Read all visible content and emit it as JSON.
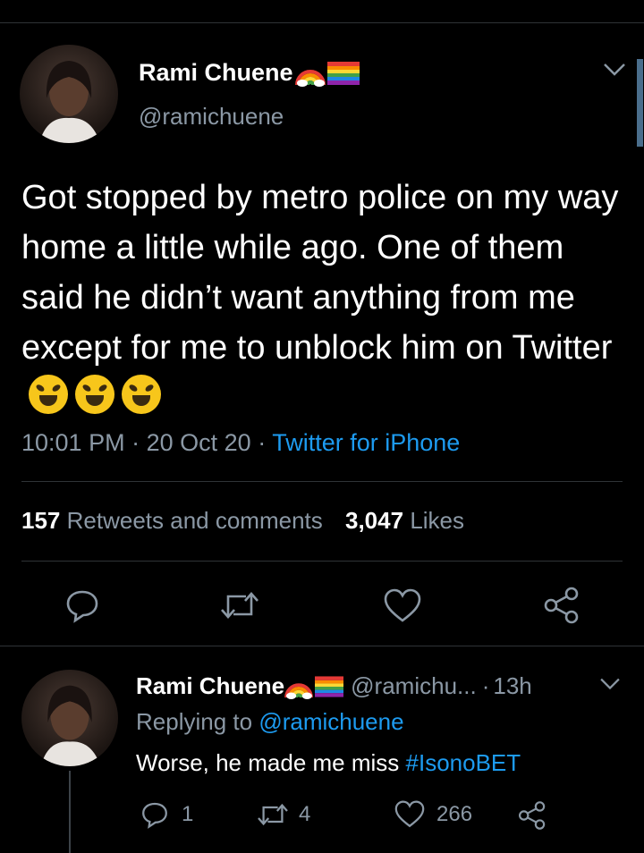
{
  "main_tweet": {
    "display_name": "Rami Chuene",
    "handle": "@ramichuene",
    "text": "Got stopped by metro police on my way home a little while ago. One of them said he didn’t want anything from me except for me to unblock him on Twitter",
    "emoji": "🤣🤣🤣",
    "time": "10:01 PM",
    "date": "20 Oct 20",
    "source": "Twitter for iPhone",
    "retweets_count": "157",
    "retweets_label": "Retweets and comments",
    "likes_count": "3,047",
    "likes_label": "Likes",
    "sep": "·"
  },
  "reply": {
    "display_name": "Rami Chuene",
    "handle": "@ramichu...",
    "age": "13h",
    "replying_prefix": "Replying to",
    "replying_handle": "@ramichuene",
    "text_prefix": "Worse, he made me miss",
    "hashtag": "#IsonoBET",
    "reply_count": "1",
    "retweet_count": "4",
    "like_count": "266",
    "sep": "·"
  },
  "icons": [
    "chevron-down-icon",
    "rainbow-icon",
    "pride-flag-icon",
    "reply-icon",
    "retweet-icon",
    "like-icon",
    "share-icon"
  ],
  "colors": {
    "background": "#000000",
    "accent": "#1d9bf0",
    "muted": "#8b98a5",
    "divider": "#2f3336"
  }
}
